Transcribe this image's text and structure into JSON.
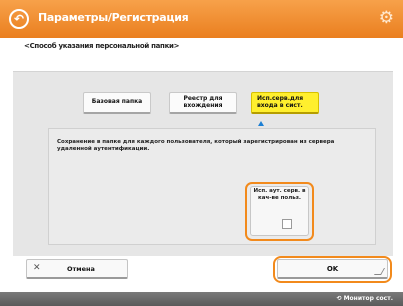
{
  "header": {
    "title": "Параметры/Регистрация"
  },
  "subtitle": "<Способ указания персональной папки>",
  "options": [
    {
      "label": "Базовая папка"
    },
    {
      "label": "Реестр для вхождения"
    },
    {
      "label": "Исп.серв.для входа в сист.",
      "selected": true
    }
  ],
  "description": "Сохранение в папке для каждого пользователя, который зарегистрирован из сервера удаленной аутентификации.",
  "inner_option": {
    "label": "Исп. аут. серв. в кач-ве польз."
  },
  "buttons": {
    "cancel": "Отмена",
    "ok": "OK"
  },
  "footer": {
    "status": "Монитор сост."
  },
  "colors": {
    "header": "#ea7f1f",
    "highlight": "#f28a1c",
    "selected": "#ffef2e",
    "triangle": "#1c7fd4"
  }
}
